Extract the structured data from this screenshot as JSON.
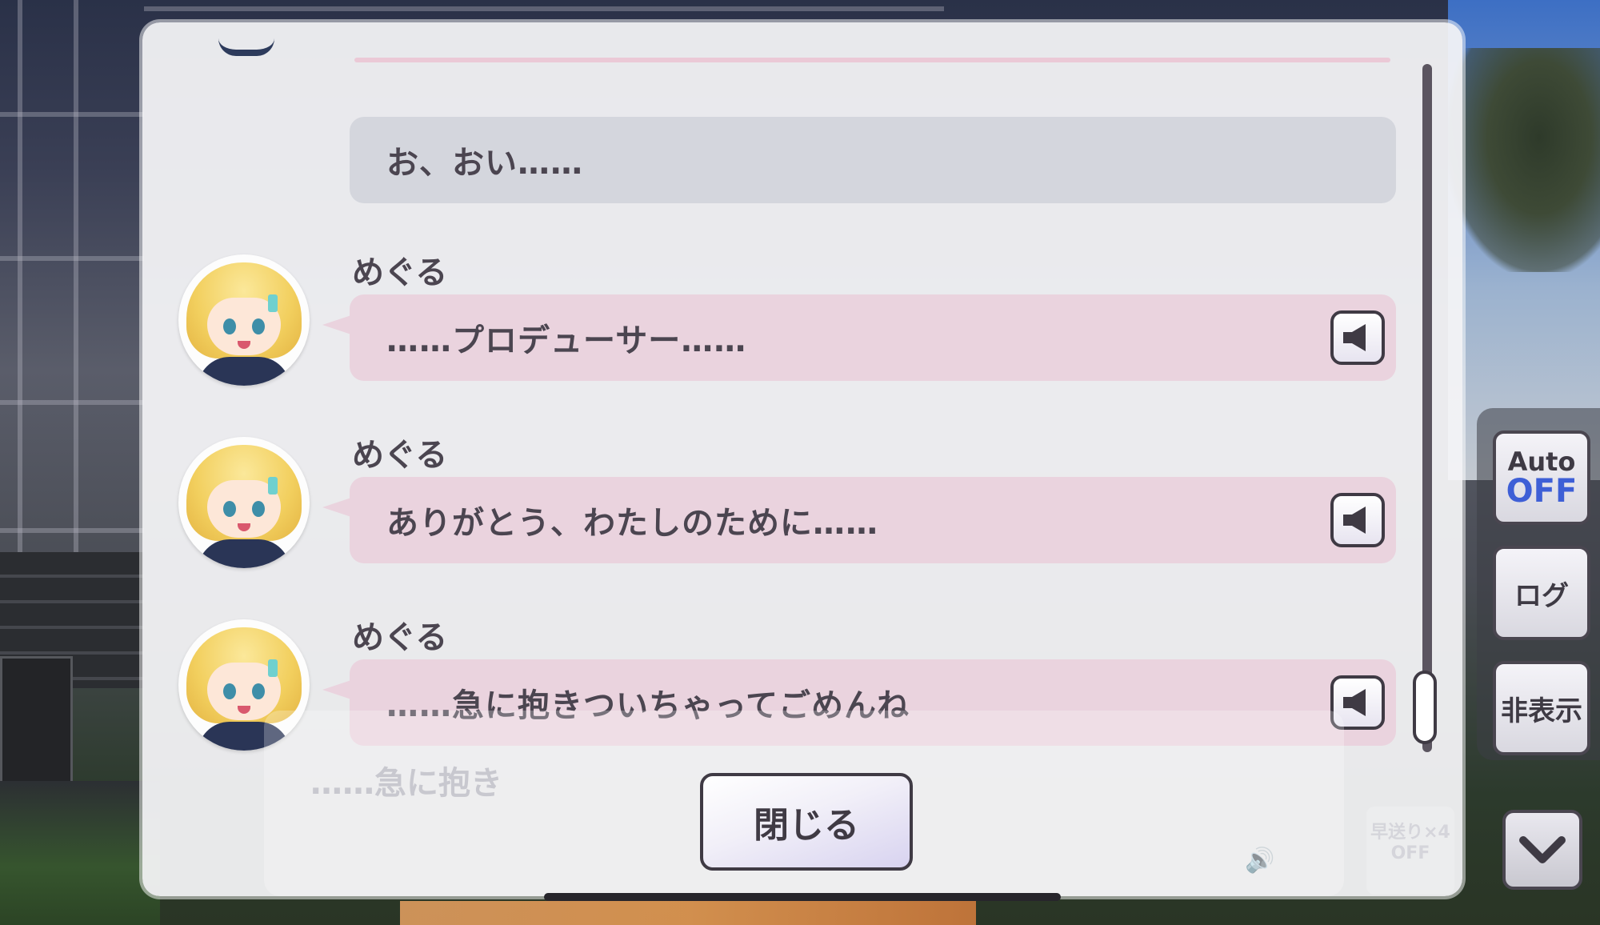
{
  "dialog": {
    "close_label": "閉じる"
  },
  "log": [
    {
      "speaker": "",
      "text": "お、おい……",
      "type": "self"
    },
    {
      "speaker": "めぐる",
      "text": "……プロデューサー……",
      "type": "character",
      "has_voice": true
    },
    {
      "speaker": "めぐる",
      "text": "ありがとう、わたしのために……",
      "type": "character",
      "has_voice": true
    },
    {
      "speaker": "めぐる",
      "text": "……急に抱きついちゃってごめんね",
      "type": "character",
      "has_voice": true
    }
  ],
  "background_ghost_text": "……急に抱き",
  "controls": {
    "auto_label": "Auto",
    "auto_state": "OFF",
    "log_label": "ログ",
    "hide_label": "非表示",
    "fast_forward_ghost": "早送り×4\nOFF"
  },
  "colors": {
    "self_bubble": "#d4d6dd",
    "character_bubble": "#ead3de",
    "auto_off": "#3e5fd6",
    "text": "#4b4550"
  },
  "icons": {
    "voice": "speaker-icon",
    "scroll_down": "chevron-down-icon"
  }
}
